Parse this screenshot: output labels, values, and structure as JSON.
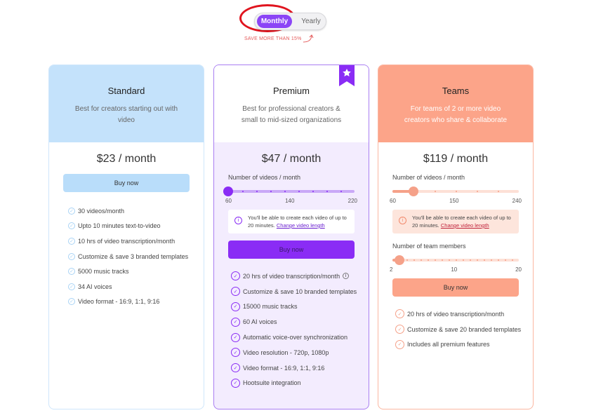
{
  "billing_toggle": {
    "monthly": "Monthly",
    "yearly": "Yearly",
    "selected": "Monthly",
    "save_note": "SAVE MORE THAN 15%"
  },
  "plans": [
    {
      "name": "Standard",
      "desc": "Best for creators starting out with video",
      "price": "$23 / month",
      "buy": "Buy now",
      "features": [
        "30 videos/month",
        "Upto 10 minutes text-to-video",
        "10 hrs of video transcription/month",
        "Customize & save 3 branded templates",
        "5000 music tracks",
        "34 AI voices",
        "Video format - 16:9, 1:1, 9:16"
      ]
    },
    {
      "name": "Premium",
      "desc": "Best for professional creators & small to mid-sized organizations",
      "price": "$47 / month",
      "buy": "Buy now",
      "badge": "star-icon",
      "slider": {
        "label": "Number of videos / month",
        "min": "60",
        "mid": "140",
        "max": "220",
        "value": 60
      },
      "note": {
        "text": "You'll be able to create each video of up to 20 minutes.",
        "link": "Change video length"
      },
      "features": [
        "20 hrs of video transcription/month",
        "Customize & save 10 branded templates",
        "15000 music tracks",
        "60 AI voices",
        "Automatic voice-over synchronization",
        "Video resolution - 720p, 1080p",
        "Video format - 16:9, 1:1, 9:16",
        "Hootsuite integration"
      ]
    },
    {
      "name": "Teams",
      "desc": "For teams of 2 or more video creators who share & collaborate",
      "price": "$119 / month",
      "buy": "Buy now",
      "slider": {
        "label": "Number of videos / month",
        "min": "60",
        "mid": "150",
        "max": "240",
        "value": 90
      },
      "note": {
        "text": "You'll be able to create each video of up to 20 minutes.",
        "link": "Change video length"
      },
      "slider2": {
        "label": "Number of team members",
        "min": "2",
        "mid": "10",
        "max": "20",
        "value": 3
      },
      "features": [
        "20 hrs of video transcription/month",
        "Customize & save 20 branded templates",
        "Includes all premium features"
      ]
    }
  ],
  "colors": {
    "standard": "#c4e2fb",
    "premium": "#8a2cf5",
    "teams": "#fca489"
  }
}
